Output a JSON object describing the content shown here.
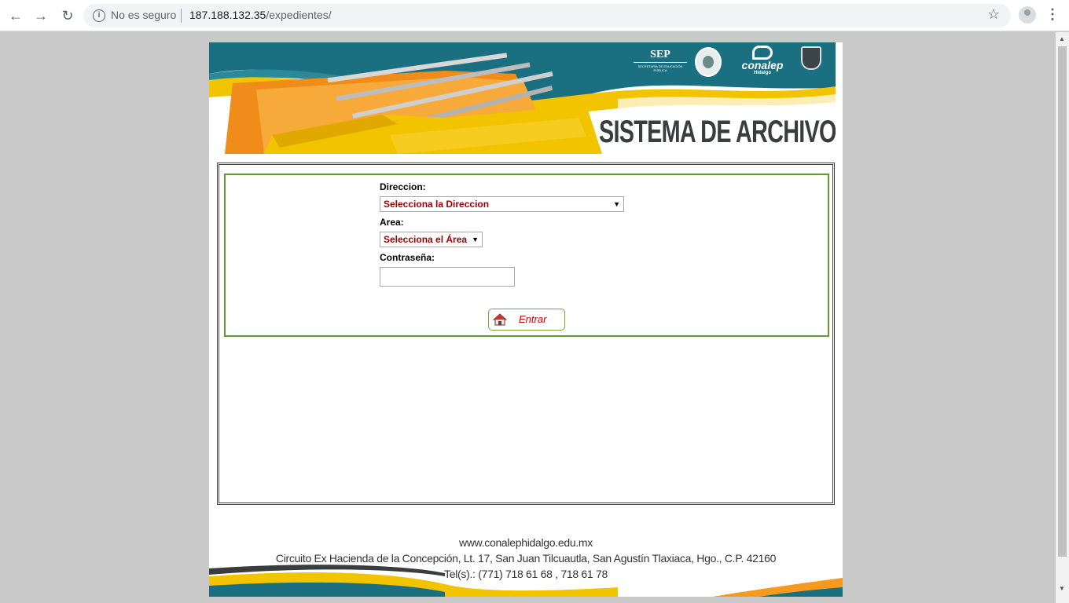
{
  "browser": {
    "security_label": "No es seguro",
    "url_host": "187.188.132.35",
    "url_path": "/expedientes/"
  },
  "banner": {
    "title": "SISTEMA DE ARCHIVO",
    "logos": {
      "sep": "SEP",
      "sep_sub": "SECRETARÍA DE EDUCACIÓN PÚBLICA",
      "conalep": "conalep",
      "conalep_sub": "Hidalgo"
    }
  },
  "form": {
    "direccion_label": "Direccion:",
    "direccion_selected": "Selecciona la Direccion",
    "area_label": "Area:",
    "area_selected": "Selecciona el Área",
    "password_label": "Contraseña:",
    "password_value": "",
    "submit_label": "Entrar"
  },
  "footer": {
    "website": "www.conalephidalgo.edu.mx",
    "address": "Circuito Ex Hacienda de la Concepción, Lt. 17, San Juan Tilcuautla, San Agustín Tlaxiaca, Hgo., C.P. 42160",
    "phones": "Tel(s).: (771) 718 61 68 , 718 61 78"
  },
  "colors": {
    "teal": "#1a6f80",
    "yellow": "#f2c400",
    "orange": "#f59a1e",
    "green_border": "#669933",
    "select_text": "#990000"
  }
}
